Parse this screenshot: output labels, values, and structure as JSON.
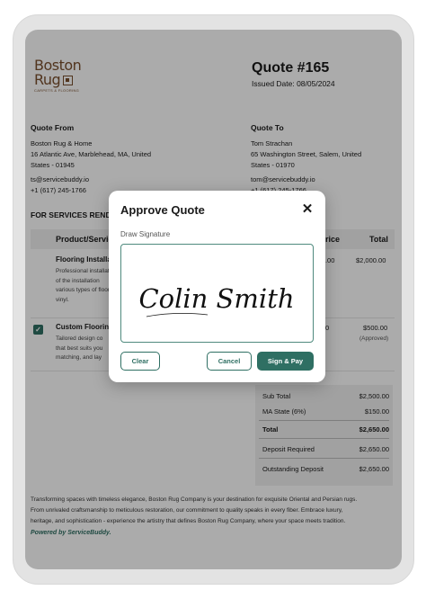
{
  "logo": {
    "line1": "Boston",
    "line2": "Rug",
    "tagline": "CARPETS & FLOORING"
  },
  "quote": {
    "number": "Quote #165",
    "issued": "Issued Date: 08/05/2024"
  },
  "from": {
    "heading": "Quote From",
    "name": "Boston Rug & Home",
    "address1": "16 Atlantic Ave, Marblehead, MA, United",
    "address2": "States - 01945",
    "email": "ts@servicebuddy.io",
    "phone": "+1 (617) 245-1766"
  },
  "to": {
    "heading": "Quote To",
    "name": "Tom Strachan",
    "address1": "65 Washington Street, Salem, United",
    "address2": "States - 01970",
    "email": "tom@servicebuddy.io",
    "phone": "+1 (617) 245-1766"
  },
  "services": {
    "heading": "FOR SERVICES RENDERED",
    "columns": {
      "product": "Product/Service",
      "price": "Price",
      "total": "Total"
    },
    "items": [
      {
        "title": "Flooring Installation",
        "desc": [
          "Professional installation",
          "of the installation",
          "various types of flooring",
          "vinyl."
        ],
        "price": "$2,000.00",
        "total": "$2,000.00",
        "checked": false
      },
      {
        "title": "Custom Flooring",
        "desc": [
          "Tailored design co",
          "that best suits you",
          "matching, and lay"
        ],
        "price": "$500.00",
        "total": "$500.00",
        "status": "(Approved)",
        "checked": true
      }
    ]
  },
  "totals": {
    "subtotal_label": "Sub Total",
    "subtotal": "$2,500.00",
    "tax_label": "MA State (6%)",
    "tax": "$150.00",
    "total_label": "Total",
    "total": "$2,650.00",
    "deposit_label": "Deposit Required",
    "deposit": "$2,650.00",
    "outstanding_label": "Outstanding Deposit",
    "outstanding": "$2,650.00"
  },
  "footer": {
    "line1": "Transforming spaces with timeless elegance, Boston Rug Company is your destination for exquisite Oriental and Persian rugs.",
    "line2": "From unrivaled craftsmanship to meticulous restoration, our commitment to quality speaks in every fiber. Embrace luxury,",
    "line3": "heritage, and sophistication - experience the artistry that defines Boston Rug Company, where your space meets tradition.",
    "powered": "Powered by ServiceBuddy."
  },
  "modal": {
    "title": "Approve Quote",
    "label": "Draw Signature",
    "signature": "Colin Smith",
    "clear": "Clear",
    "cancel": "Cancel",
    "sign": "Sign & Pay"
  },
  "colors": {
    "accent": "#2f6f63",
    "brand": "#7a4f2e"
  },
  "icons": {
    "close": "close-icon",
    "check": "checkbox-checked-icon"
  }
}
